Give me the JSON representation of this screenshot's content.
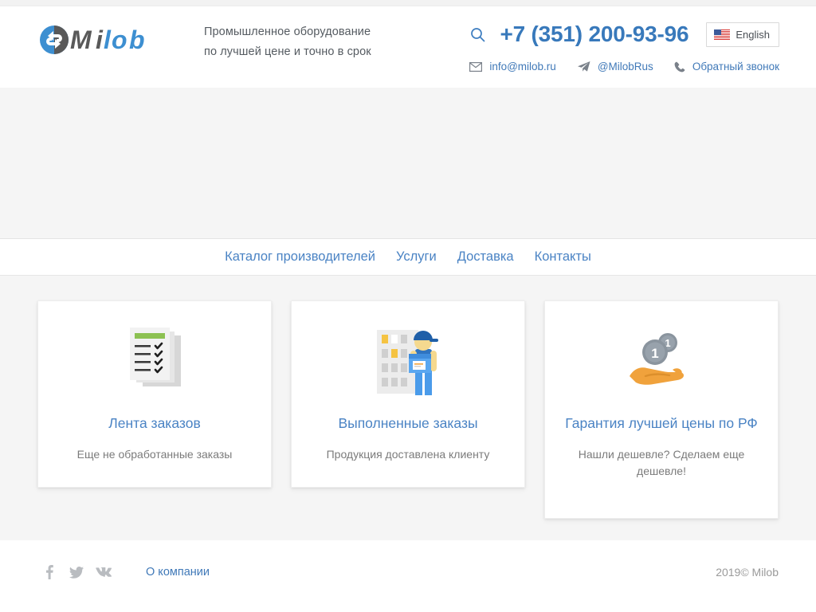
{
  "header": {
    "logo_text": "Milob",
    "tagline_line1": "Промышленное оборудование",
    "tagline_line2": "по лучшей цене и точно в срок",
    "search_icon": "search-icon",
    "phone": "+7 (351) 200-93-96",
    "language": {
      "label": "English",
      "flag": "us-flag-icon"
    },
    "contacts": [
      {
        "icon": "envelope-icon",
        "text": "info@milob.ru"
      },
      {
        "icon": "telegram-icon",
        "text": "@MilobRus"
      },
      {
        "icon": "phone-handset-icon",
        "text": "Обратный звонок"
      }
    ]
  },
  "nav": {
    "items": [
      {
        "label": "Каталог производителей"
      },
      {
        "label": "Услуги"
      },
      {
        "label": "Доставка"
      },
      {
        "label": "Контакты"
      }
    ]
  },
  "main": {
    "cards": [
      {
        "icon": "checklist-icon",
        "title": "Лента заказов",
        "desc": "Еще не обработанные заказы"
      },
      {
        "icon": "delivery-worker-icon",
        "title": "Выполненные заказы",
        "desc": "Продукция доставлена клиенту"
      },
      {
        "icon": "hand-with-coins-icon",
        "title": "Гарантия лучшей цены по РФ",
        "desc": "Нашли дешевле? Сделаем еще дешевле!"
      }
    ]
  },
  "footer": {
    "social": [
      {
        "icon": "facebook-icon"
      },
      {
        "icon": "twitter-icon"
      },
      {
        "icon": "vk-icon"
      }
    ],
    "about_label": "О компании",
    "copyright": "2019© Milob"
  },
  "colors": {
    "brand_blue": "#3879bb",
    "link_blue": "#4a83c4",
    "page_bg": "#f5f5f5",
    "muted_text": "#7b7b7b",
    "accent_green": "#8cc152",
    "accent_orange": "#f0a23c"
  }
}
